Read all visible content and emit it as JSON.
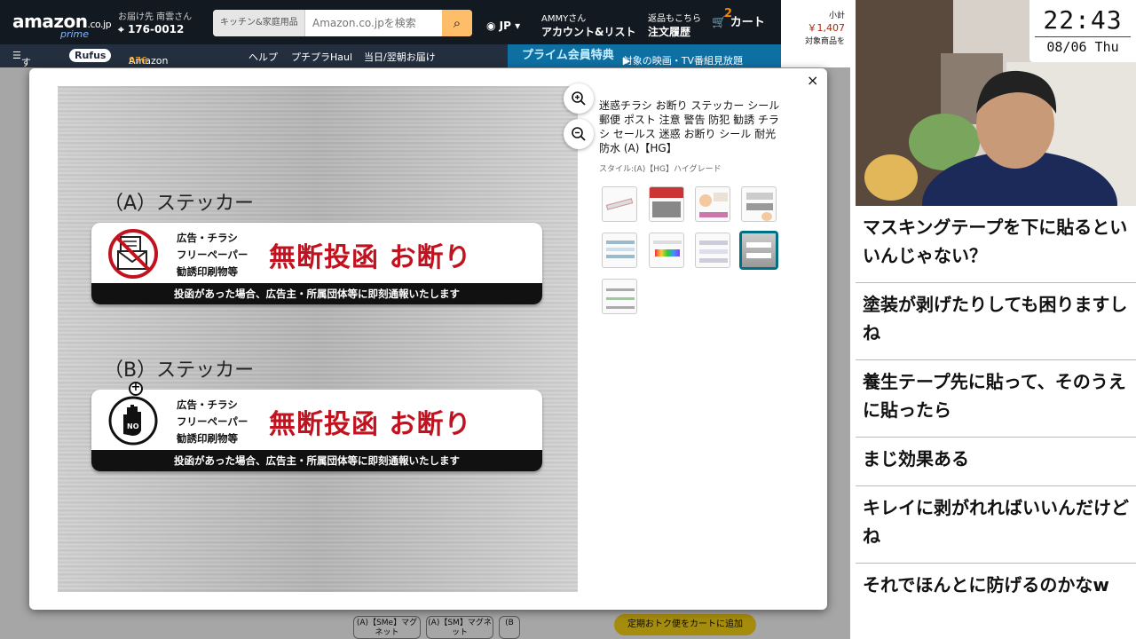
{
  "amazon": {
    "logo": "amazon",
    "logo_domain": ".co.jp",
    "prime_label": "prime",
    "deliver_to": "お届け先 南雲さん",
    "zip": "176-0012",
    "search_category": "キッチン&家庭用品",
    "search_placeholder": "Amazon.co.jpを検索",
    "lang": "JP",
    "account_greeting": "AMMYさん",
    "account_label": "アカウント&リスト",
    "returns_label": "返品もこちら",
    "orders_label": "注文履歴",
    "cart_count": "2",
    "cart_label": "カート",
    "subtotal_label": "小計",
    "subtotal_price": "￥1,407",
    "subtotal_note": "対象商品を",
    "nav_all": "すべて",
    "nav_rufus": "Rufus",
    "nav_points_label": "Amazonポイント:",
    "nav_points_value": "976",
    "nav_help": "ヘルプ",
    "nav_haul": "プチプラHaul",
    "nav_delivery": "当日/翌朝お届け",
    "prime_banner_title": "プライム会員特典",
    "prime_banner_text": "対象の映画・TV番組見放題",
    "bottom_styles": [
      "(A)【SMe】マグネット",
      "(A)【SM】マグネット",
      "(B"
    ],
    "add_button": "定期おトク便をカートに追加"
  },
  "modal": {
    "title": "迷惑チラシ お断り ステッカー シール 郵便 ポスト 注意 警告 防犯 勧誘 チラシ セールス 迷惑 お断り シール 耐光 防水 (A)【HG】",
    "style": "スタイル:(A)【HG】ハイグレード",
    "zoom_in_icon": "zoom-in-icon",
    "zoom_out_icon": "zoom-out-icon",
    "close_icon": "×",
    "thumbnail_count": 9,
    "selected_thumbnail": 7,
    "stickers": [
      {
        "heading": "（A）ステッカー",
        "icon": "no-flyer-icon",
        "sub": [
          "広告・チラシ",
          "フリーペーパー",
          "勧誘印刷物等"
        ],
        "main": "無断投函 お断り",
        "band": "投函があった場合、広告主・所属団体等に即刻通報いたします"
      },
      {
        "heading": "（B）ステッカー",
        "icon": "stop-hand-icon",
        "sub": [
          "広告・チラシ",
          "フリーペーパー",
          "勧誘印刷物等"
        ],
        "main": "無断投函 お断り",
        "band": "投函があった場合、広告主・所属団体等に即刻通報いたします"
      }
    ]
  },
  "clock": {
    "time": "22:43",
    "date": "08/06 Thu"
  },
  "chat": [
    "マスキングテープを下に貼るといいんじゃない？",
    "塗装が剥げたりしても困りますしね",
    "養生テープ先に貼って、そのうえに貼ったら",
    "まじ効果ある",
    "キレイに剥がれればいいんだけどね",
    "それでほんとに防げるのかなw"
  ],
  "colors": {
    "amazon_dark": "#131921",
    "amazon_nav": "#232f3e",
    "sticker_red": "#c1121f",
    "selected_thumb": "#007185"
  }
}
